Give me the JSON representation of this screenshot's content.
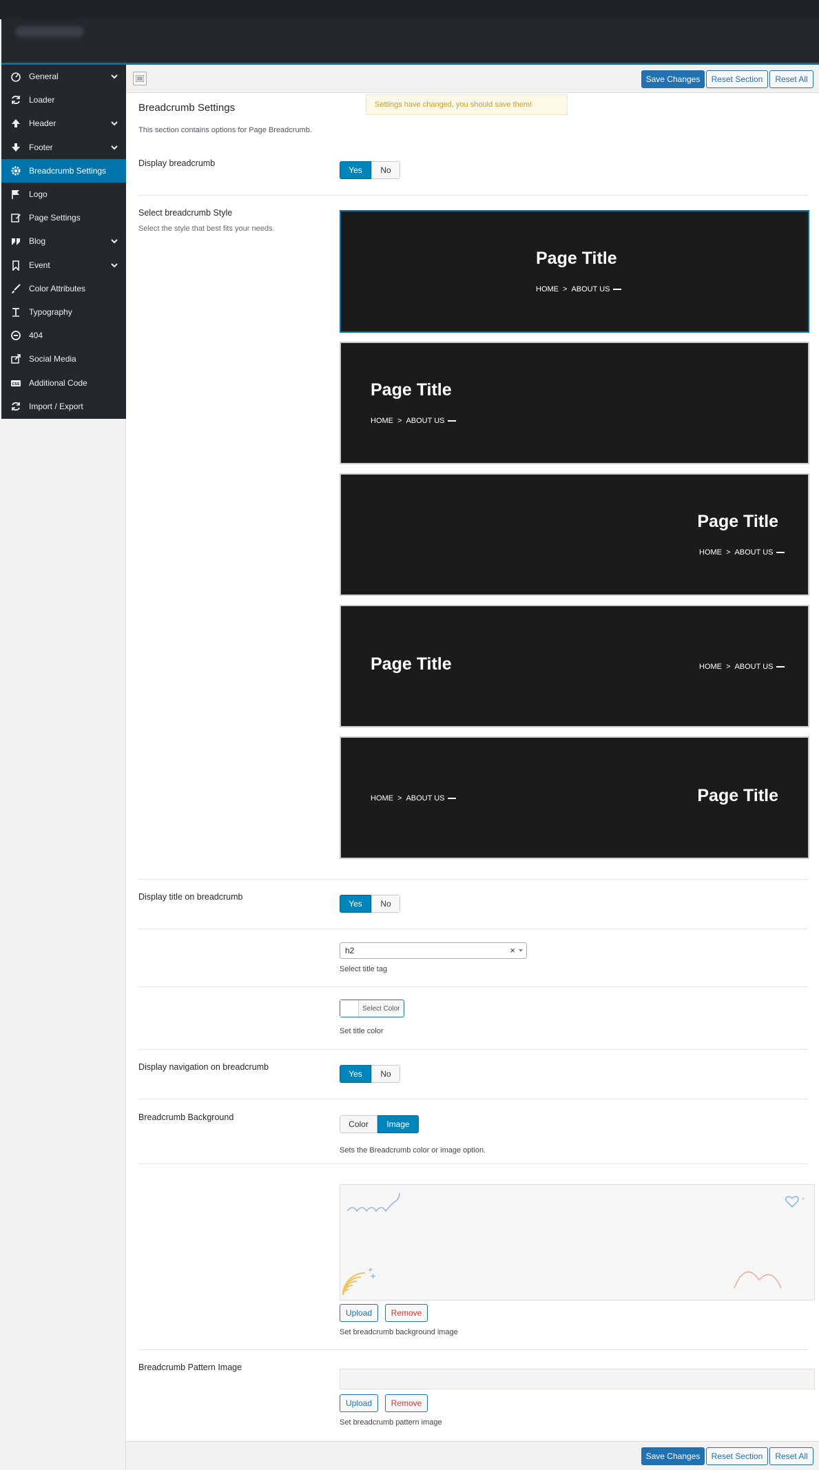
{
  "sidebar": {
    "items": [
      {
        "label": "General",
        "icon": "dashboard-icon",
        "has_children": true
      },
      {
        "label": "Loader",
        "icon": "refresh-icon",
        "has_children": false
      },
      {
        "label": "Header",
        "icon": "arrow-up-icon",
        "has_children": true
      },
      {
        "label": "Footer",
        "icon": "arrow-down-icon",
        "has_children": true
      },
      {
        "label": "Breadcrumb Settings",
        "icon": "gear-icon",
        "has_children": false,
        "active": true
      },
      {
        "label": "Logo",
        "icon": "flag-icon",
        "has_children": false
      },
      {
        "label": "Page Settings",
        "icon": "edit-icon",
        "has_children": false
      },
      {
        "label": "Blog",
        "icon": "quote-icon",
        "has_children": true
      },
      {
        "label": "Event",
        "icon": "bookmark-icon",
        "has_children": true
      },
      {
        "label": "Color Attributes",
        "icon": "brush-icon",
        "has_children": false
      },
      {
        "label": "Typography",
        "icon": "text-icon",
        "has_children": false
      },
      {
        "label": "404",
        "icon": "minus-circle-icon",
        "has_children": false
      },
      {
        "label": "Social Media",
        "icon": "share-icon",
        "has_children": false
      },
      {
        "label": "Additional Code",
        "icon": "css-icon",
        "has_children": false
      },
      {
        "label": "Import / Export",
        "icon": "refresh-icon",
        "has_children": false
      }
    ]
  },
  "toolbar": {
    "save_label": "Save Changes",
    "reset_section_label": "Reset Section",
    "reset_all_label": "Reset All"
  },
  "notice": "Settings have changed, you should save them!",
  "section": {
    "title": "Breadcrumb Settings",
    "description": "This section contains options for Page Breadcrumb."
  },
  "fields": {
    "display_breadcrumb": {
      "label": "Display breadcrumb",
      "yes": "Yes",
      "no": "No",
      "value": "Yes"
    },
    "style": {
      "label": "Select breadcrumb Style",
      "sub": "Select the style that best fits your needs.",
      "preview_title": "Page Title",
      "crumb_home": "HOME",
      "crumb_sep": ">",
      "crumb_about": "ABOUT US",
      "selected_index": 0
    },
    "display_title": {
      "label": "Display title on breadcrumb",
      "yes": "Yes",
      "no": "No",
      "value": "Yes"
    },
    "title_tag": {
      "value": "h2",
      "clear": "×",
      "helper": "Select title tag"
    },
    "title_color": {
      "button_label": "Select Color",
      "helper": "Set title color"
    },
    "display_nav": {
      "label": "Display navigation on breadcrumb",
      "yes": "Yes",
      "no": "No",
      "value": "Yes"
    },
    "background": {
      "label": "Breadcrumb Background",
      "color": "Color",
      "image": "Image",
      "value": "Image",
      "helper": "Sets the Breadcrumb color or image option."
    },
    "bg_image": {
      "upload": "Upload",
      "remove": "Remove",
      "helper": "Set breadcrumb background image"
    },
    "pattern": {
      "label": "Breadcrumb Pattern Image",
      "upload": "Upload",
      "remove": "Remove",
      "helper": "Set breadcrumb pattern image"
    }
  },
  "colors": {
    "accent": "#0073aa",
    "primary_button": "#2271b1",
    "sidebar_bg": "#23282d",
    "card_bg": "#1b1b1c"
  }
}
